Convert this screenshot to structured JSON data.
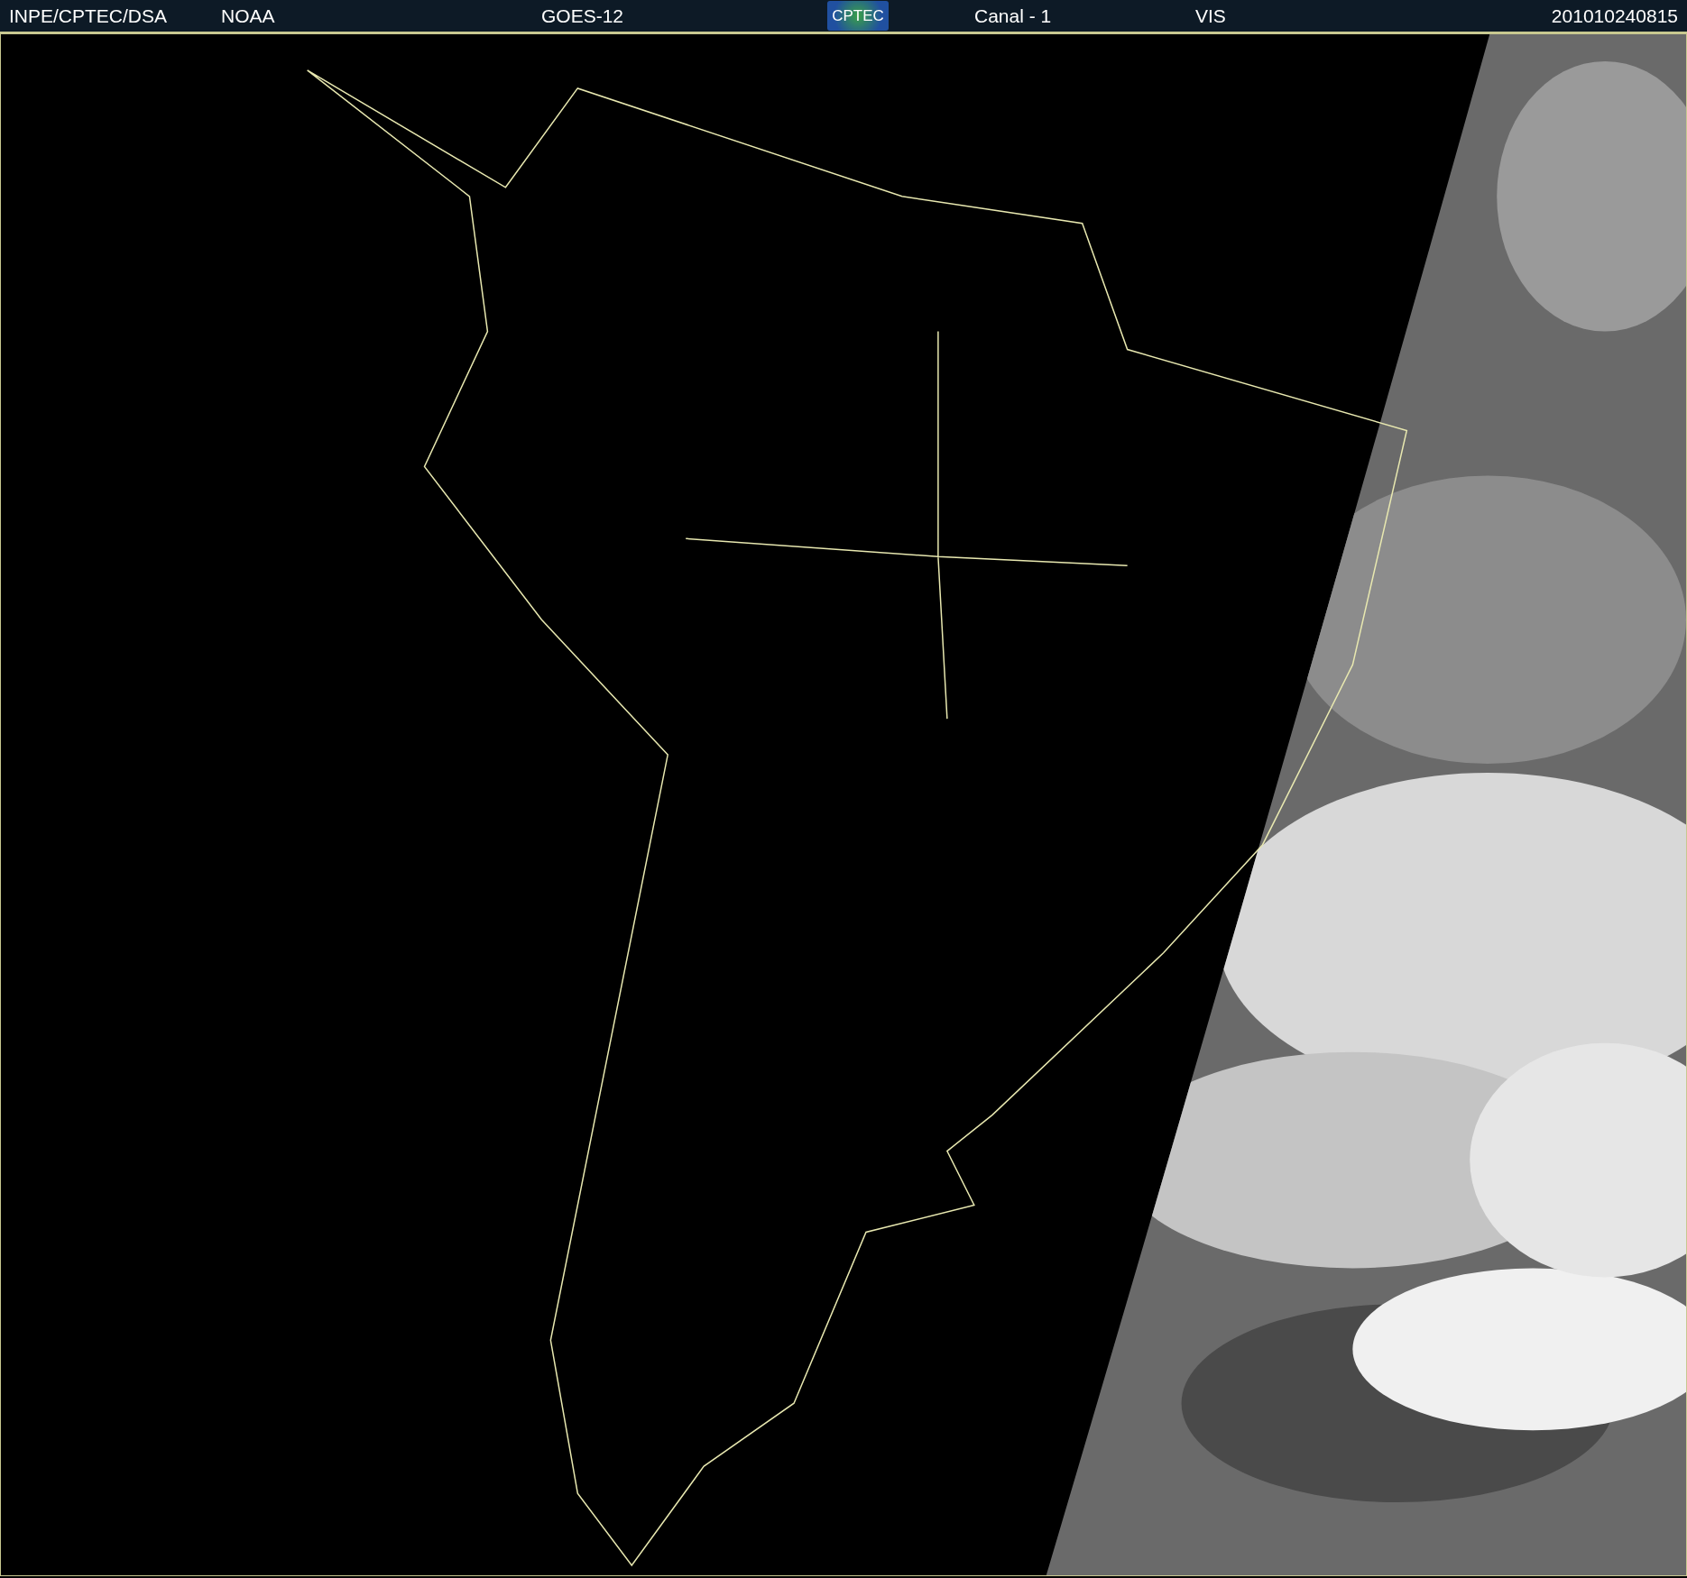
{
  "header": {
    "source": "INPE/CPTEC/DSA",
    "agency": "NOAA",
    "satellite": "GOES-12",
    "logo_text": "CPTEC",
    "channel": "Canal - 1",
    "band": "VIS",
    "timestamp": "201010240815"
  }
}
